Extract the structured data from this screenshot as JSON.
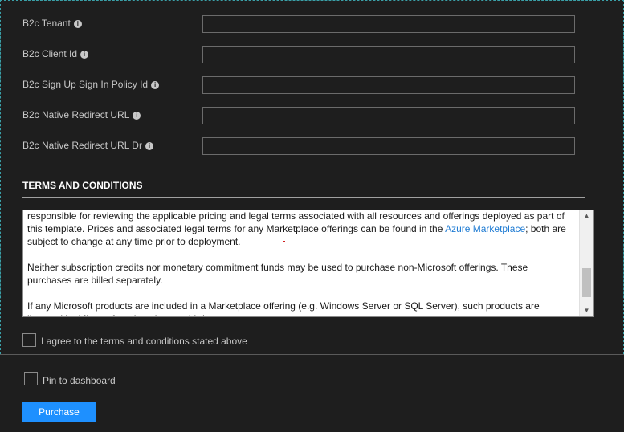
{
  "fields": [
    {
      "label": "B2c Tenant",
      "value": ""
    },
    {
      "label": "B2c Client Id",
      "value": ""
    },
    {
      "label": "B2c Sign Up Sign In Policy Id",
      "value": ""
    },
    {
      "label": "B2c Native Redirect URL",
      "value": ""
    },
    {
      "label": "B2c Native Redirect URL Dr",
      "value": ""
    }
  ],
  "terms": {
    "title": "TERMS AND CONDITIONS",
    "para1_a": "responsible for reviewing the applicable pricing and legal terms associated with all resources and offerings deployed as part of this template.  Prices and associated legal terms for any Marketplace offerings can be found in the ",
    "para1_link": "Azure Marketplace",
    "para1_b": "; both are subject to change at any time prior to deployment.",
    "para2": "Neither subscription credits nor monetary commitment funds may be used to purchase non-Microsoft offerings. These purchases are billed separately.",
    "para3": "If any Microsoft products are included in a Marketplace offering (e.g. Windows Server or SQL Server), such products are licensed by Microsoft and not by any third party.",
    "agree_label": "I agree to the terms and conditions stated above",
    "agree_checked": false
  },
  "footer": {
    "pin_label": "Pin to dashboard",
    "pin_checked": false,
    "purchase_label": "Purchase"
  },
  "colors": {
    "background": "#1e1e1e",
    "accent": "#1e90ff",
    "link": "#1e7bd3"
  },
  "icons": {
    "info": "info-circle-icon",
    "scroll_up": "scroll-up-arrow-icon",
    "scroll_down": "scroll-down-arrow-icon"
  }
}
